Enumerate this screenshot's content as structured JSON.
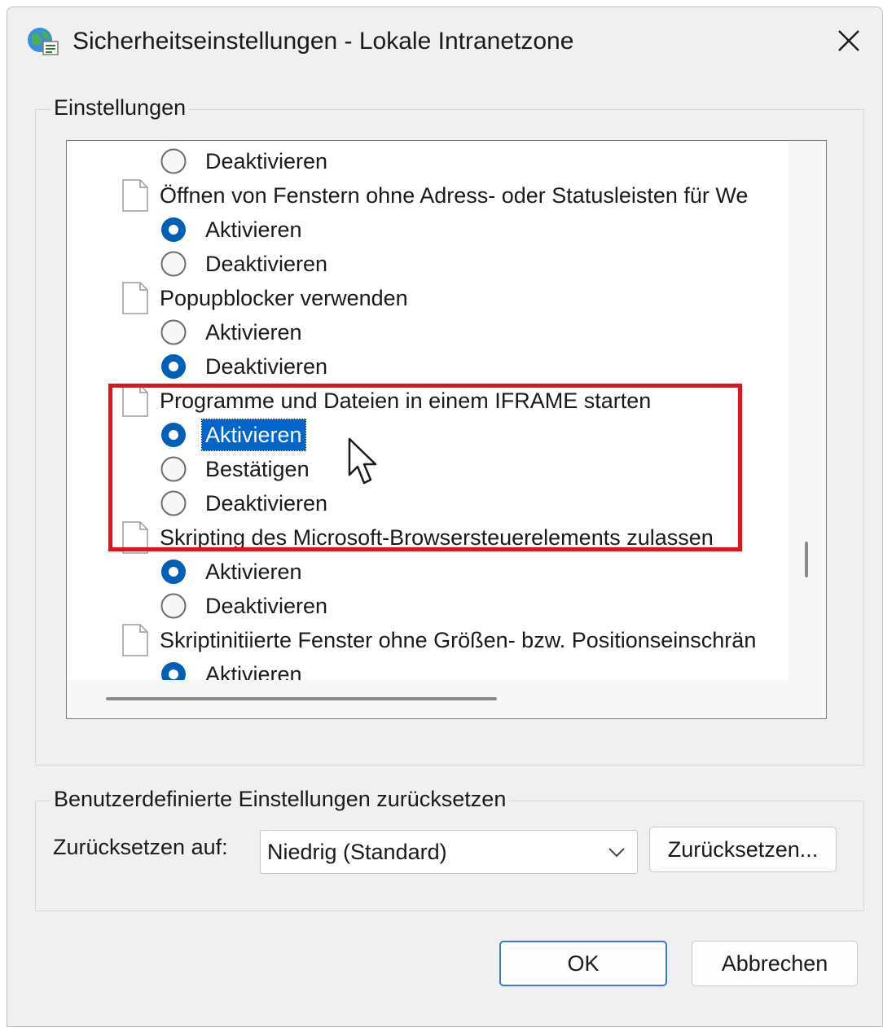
{
  "window": {
    "title": "Sicherheitseinstellungen - Lokale Intranetzone"
  },
  "settings": {
    "group_label": "Einstellungen",
    "rows": [
      {
        "kind": "radio",
        "label": "Deaktivieren",
        "checked": false,
        "selected": false
      },
      {
        "kind": "setting",
        "label": "Öffnen von Fenstern ohne Adress- oder Statusleisten für We"
      },
      {
        "kind": "radio",
        "label": "Aktivieren",
        "checked": true,
        "selected": false
      },
      {
        "kind": "radio",
        "label": "Deaktivieren",
        "checked": false,
        "selected": false
      },
      {
        "kind": "setting",
        "label": "Popupblocker verwenden"
      },
      {
        "kind": "radio",
        "label": "Aktivieren",
        "checked": false,
        "selected": false
      },
      {
        "kind": "radio",
        "label": "Deaktivieren",
        "checked": true,
        "selected": false
      },
      {
        "kind": "setting",
        "label": "Programme und Dateien in einem IFRAME starten"
      },
      {
        "kind": "radio",
        "label": "Aktivieren",
        "checked": true,
        "selected": true
      },
      {
        "kind": "radio",
        "label": "Bestätigen",
        "checked": false,
        "selected": false
      },
      {
        "kind": "radio",
        "label": "Deaktivieren",
        "checked": false,
        "selected": false
      },
      {
        "kind": "setting",
        "label": "Skripting des Microsoft-Browsersteuerelements zulassen"
      },
      {
        "kind": "radio",
        "label": "Aktivieren",
        "checked": true,
        "selected": false
      },
      {
        "kind": "radio",
        "label": "Deaktivieren",
        "checked": false,
        "selected": false
      },
      {
        "kind": "setting",
        "label": "Skriptinitiierte Fenster ohne Größen- bzw. Positionseinschrän"
      },
      {
        "kind": "radio",
        "label": "Aktivieren",
        "checked": true,
        "selected": false
      }
    ]
  },
  "reset": {
    "group_label": "Benutzerdefinierte Einstellungen zurücksetzen",
    "reset_to_label": "Zurücksetzen auf:",
    "selected_level": "Niedrig (Standard)",
    "reset_button": "Zurücksetzen..."
  },
  "buttons": {
    "ok": "OK",
    "cancel": "Abbrechen"
  },
  "colors": {
    "selection": "#0066cc",
    "radio_checked": "#005fb8",
    "highlight_box": "#e0121c"
  }
}
